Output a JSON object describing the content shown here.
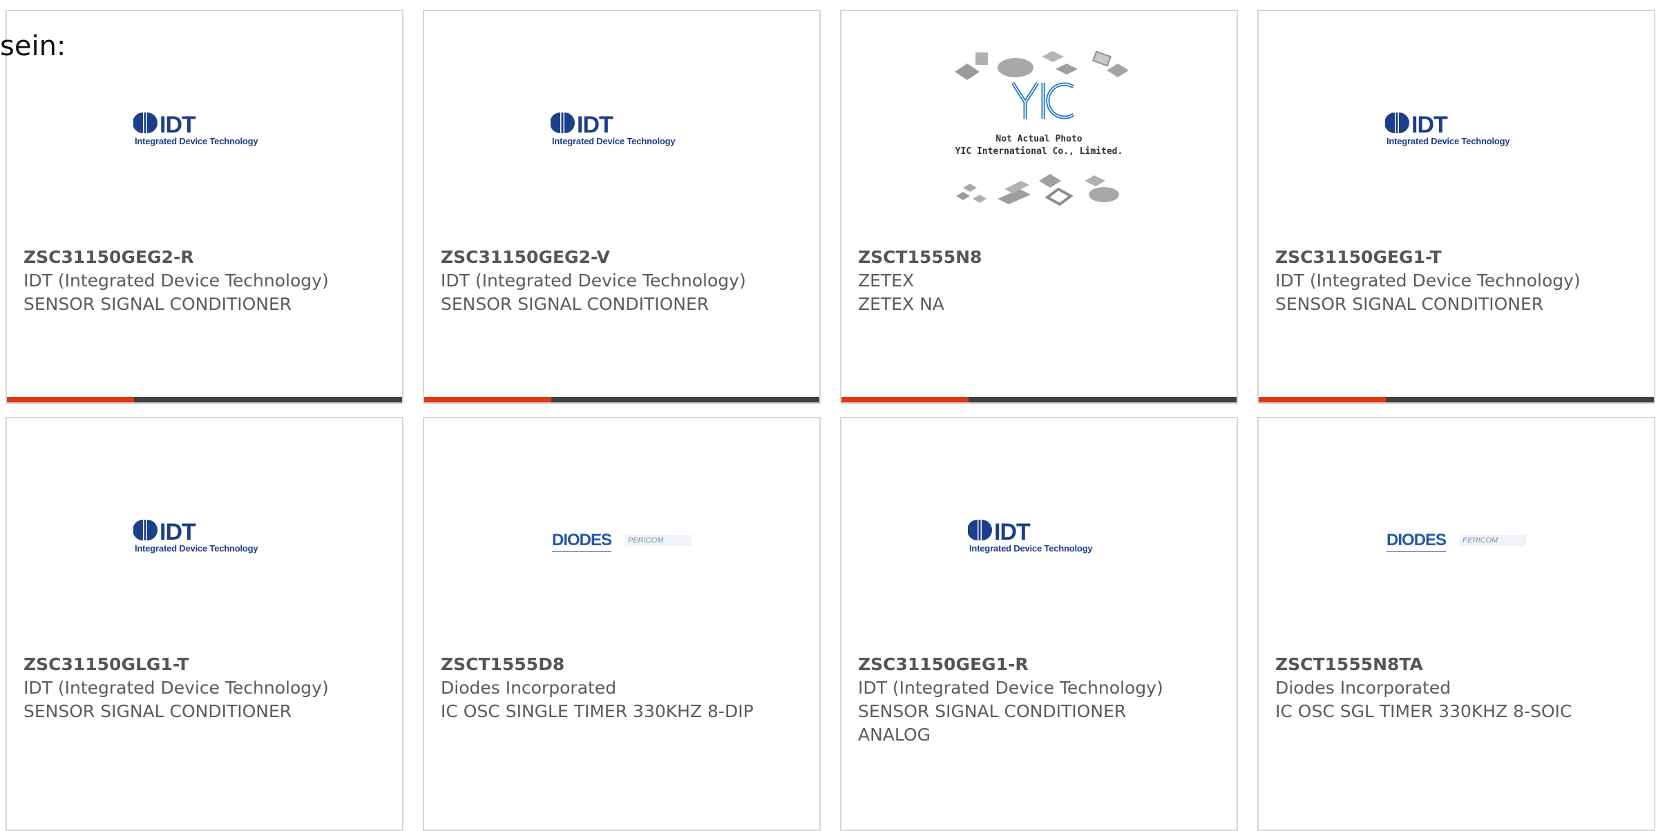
{
  "intro_text": "sein:",
  "colors": {
    "accent": "#e03a12",
    "bar": "#404040",
    "border": "#d6d6d6"
  },
  "logos": {
    "idt": {
      "wordmark": "IDT",
      "tagline": "Integrated Device Technology"
    },
    "diodes": {
      "wordmark": "DIODES",
      "partner": "PERICOM"
    },
    "placeholder": {
      "brand": "YIC",
      "line1": "Not Actual Photo",
      "line2": "YIC International Co., Limited."
    }
  },
  "products": [
    {
      "part": "ZSC31150GEG2-R",
      "manufacturer": "IDT (Integrated Device Technology)",
      "description": "SENSOR SIGNAL CONDITIONER",
      "logo": "idt"
    },
    {
      "part": "ZSC31150GEG2-V",
      "manufacturer": "IDT (Integrated Device Technology)",
      "description": "SENSOR SIGNAL CONDITIONER",
      "logo": "idt"
    },
    {
      "part": "ZSCT1555N8",
      "manufacturer": "ZETEX",
      "description": "ZETEX NA",
      "logo": "placeholder"
    },
    {
      "part": "ZSC31150GEG1-T",
      "manufacturer": "IDT (Integrated Device Technology)",
      "description": "SENSOR SIGNAL CONDITIONER",
      "logo": "idt"
    },
    {
      "part": "ZSC31150GLG1-T",
      "manufacturer": "IDT (Integrated Device Technology)",
      "description": "SENSOR SIGNAL CONDITIONER",
      "logo": "idt"
    },
    {
      "part": "ZSCT1555D8",
      "manufacturer": "Diodes Incorporated",
      "description": "IC OSC SINGLE TIMER 330KHZ 8-DIP",
      "logo": "diodes"
    },
    {
      "part": "ZSC31150GEG1-R",
      "manufacturer": "IDT (Integrated Device Technology)",
      "description": "SENSOR SIGNAL CONDITIONER ANALOG",
      "logo": "idt"
    },
    {
      "part": "ZSCT1555N8TA",
      "manufacturer": "Diodes Incorporated",
      "description": "IC OSC SGL TIMER 330KHZ 8-SOIC",
      "logo": "diodes"
    }
  ]
}
